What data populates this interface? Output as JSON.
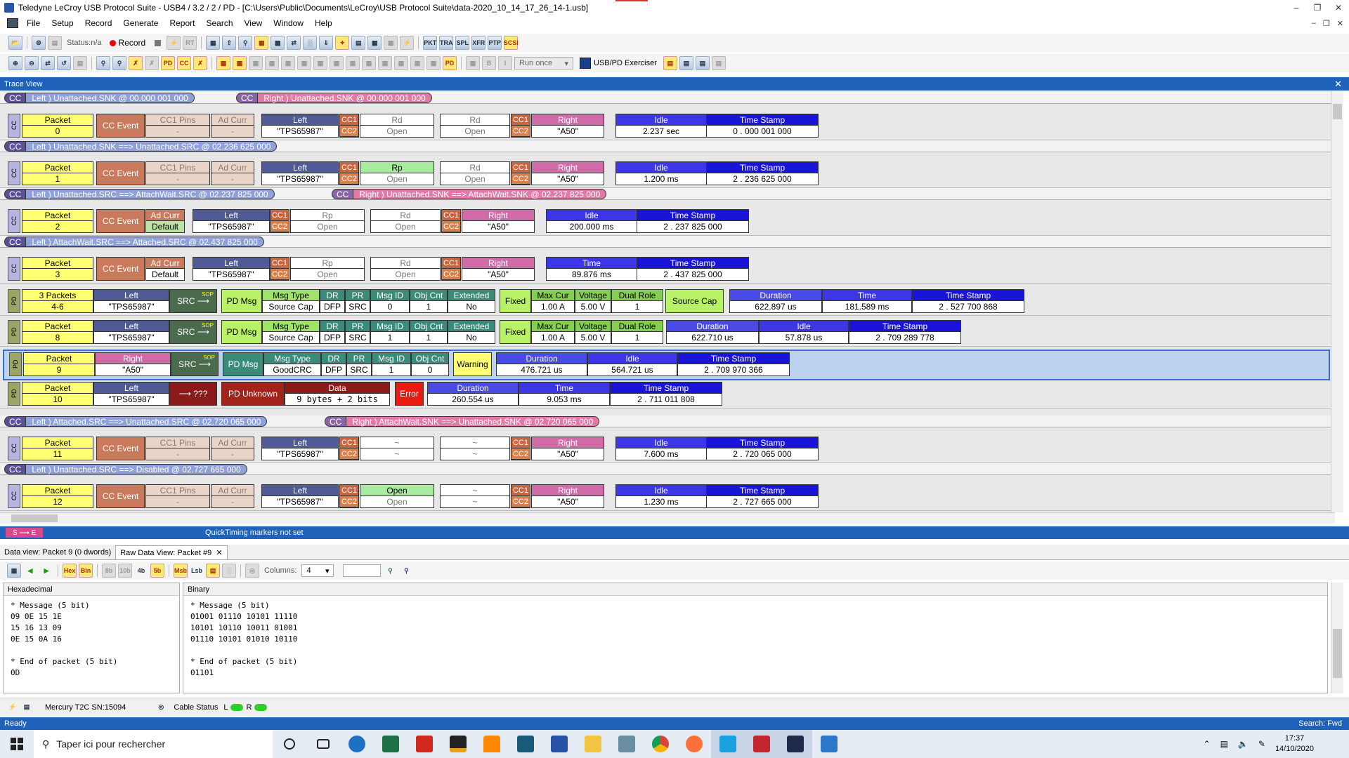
{
  "window": {
    "title": "Teledyne LeCroy USB Protocol Suite - USB4 / 3.2 / 2 / PD - [C:\\Users\\Public\\Documents\\LeCroy\\USB Protocol Suite\\data-2020_10_14_17_26_14-1.usb]"
  },
  "menu": [
    "File",
    "Setup",
    "Record",
    "Generate",
    "Report",
    "Search",
    "View",
    "Window",
    "Help"
  ],
  "toolbar": {
    "status": "Status:n/a",
    "record": "Record",
    "run_mode": "Run once",
    "exerciser": "USB/PD Exerciser"
  },
  "trace_view": {
    "title": "Trace View"
  },
  "transitions": [
    {
      "left": "Left )  Unattached.SNK @ 00.000 001 000",
      "right": "Right )  Unattached.SNK @ 00.000 001 000"
    },
    {
      "left": "Left )  Unattached.SNK ==> Unattached.SRC @ 02.236 625 000",
      "right": ""
    },
    {
      "left": "Left )  Unattached.SRC ==> AttachWait.SRC @ 02.237 825 000",
      "right": "Right )  Unattached.SNK ==> AttachWait.SNK @ 02.237 825 000"
    },
    {
      "left": "Left )  AttachWait.SRC ==> Attached.SRC @ 02.437 825 000",
      "right": ""
    },
    {
      "left": "Left )  Attached.SRC ==> Unattached.SRC @ 02.720 065 000",
      "right": "Right )  AttachWait.SNK ==> Unattached.SNK @ 02.720 065 000"
    },
    {
      "left": "Left )  Unattached.SRC ==> Disabled @ 02.727 665 000",
      "right": ""
    }
  ],
  "labels": {
    "cc": "CC",
    "pd": "PD",
    "packet": "Packet",
    "packets": "3 Packets",
    "cc_event": "CC Event",
    "cc1_pins": "CC1 Pins",
    "ad_curr": "Ad Curr",
    "left": "Left",
    "right": "Right",
    "cc1": "CC1",
    "cc2": "CC2",
    "idle": "Idle",
    "time": "Time",
    "time_stamp": "Time Stamp",
    "duration": "Duration",
    "src": "SRC",
    "sop": "SOP",
    "pd_msg": "PD Msg",
    "msg_type": "Msg Type",
    "dr": "DR",
    "pr": "PR",
    "msg_id": "Msg ID",
    "obj_cnt": "Obj Cnt",
    "extended": "Extended",
    "fixed": "Fixed",
    "max_cur": "Max Cur",
    "voltage": "Voltage",
    "dual_role": "Dual Role",
    "source_cap": "Source Cap",
    "warning": "Warning",
    "pd_unknown": "PD Unknown",
    "data": "Data",
    "error": "Error",
    "unknown_dir": "???",
    "dash": "-",
    "tilde": "~"
  },
  "cc_packets": [
    {
      "num": "0",
      "left": "\"TPS65987\"",
      "right": "\"A50\"",
      "cc1l": "Rd",
      "cc2l": "Open",
      "cc1r": "Rd",
      "cc2r": "Open",
      "idle_label": "Idle",
      "idle": "2.237 sec",
      "ts": "0 . 000 001 000"
    },
    {
      "num": "1",
      "left": "\"TPS65987\"",
      "right": "\"A50\"",
      "cc1l": "Rp",
      "cc2l": "Open",
      "cc1r": "Rd",
      "cc2r": "Open",
      "idle_label": "Idle",
      "idle": "1.200 ms",
      "ts": "2 . 236 625 000"
    },
    {
      "num": "2",
      "adcurr": "Default",
      "left": "\"TPS65987\"",
      "right": "\"A50\"",
      "cc1l": "Rp",
      "cc2l": "Open",
      "cc1r": "Rd",
      "cc2r": "Open",
      "idle_label": "Idle",
      "idle": "200.000 ms",
      "ts": "2 . 237 825 000"
    },
    {
      "num": "3",
      "adcurr": "Default",
      "left": "\"TPS65987\"",
      "right": "\"A50\"",
      "cc1l": "Rp",
      "cc2l": "Open",
      "cc1r": "Rd",
      "cc2r": "Open",
      "idle_label": "Time",
      "idle": "89.876 ms",
      "ts": "2 . 437 825 000"
    },
    {
      "num": "11",
      "left": "\"TPS65987\"",
      "right": "\"A50\"",
      "cc1l": "~",
      "cc2l": "~",
      "cc1r": "~",
      "cc2r": "~",
      "idle_label": "Idle",
      "idle": "7.600 ms",
      "ts": "2 . 720 065 000"
    },
    {
      "num": "12",
      "left": "\"TPS65987\"",
      "right": "\"A50\"",
      "cc1l": "Open",
      "cc2l": "Open",
      "cc1r": "~",
      "cc2r": "~",
      "idle_label": "Idle",
      "idle": "1.230 ms",
      "ts": "2 . 727 665 000"
    }
  ],
  "pd_packets": [
    {
      "num": "4-6",
      "who": "Left",
      "name": "\"TPS65987\"",
      "msgtype": "Source Cap",
      "dr": "DFP",
      "pr": "SRC",
      "msgid": "0",
      "objcnt": "1",
      "ext": "No",
      "maxcur": "1.00 A",
      "volt": "5.00 V",
      "dualrole": "1",
      "dur": "622.897 us",
      "time": "181.589 ms",
      "ts": "2 . 527 700 868"
    },
    {
      "num": "8",
      "who": "Left",
      "name": "\"TPS65987\"",
      "msgtype": "Source Cap",
      "dr": "DFP",
      "pr": "SRC",
      "msgid": "1",
      "objcnt": "1",
      "ext": "No",
      "maxcur": "1.00 A",
      "volt": "5.00 V",
      "dualrole": "1",
      "dur": "622.710 us",
      "idle": "57.878 us",
      "ts": "2 . 709 289 778"
    },
    {
      "num": "9",
      "who": "Right",
      "name": "\"A50\"",
      "msgtype": "GoodCRC",
      "dr": "DFP",
      "pr": "SRC",
      "msgid": "1",
      "objcnt": "0",
      "dur": "476.721 us",
      "idle": "564.721 us",
      "ts": "2 . 709 970 366"
    },
    {
      "num": "10",
      "who": "Left",
      "name": "\"TPS65987\"",
      "data": "9 bytes + 2 bits",
      "dur": "260.554 us",
      "time": "9.053 ms",
      "ts": "2 . 711 011 808"
    }
  ],
  "quicktiming": {
    "se": "S ⟶ E",
    "msg": "QuickTiming markers not set"
  },
  "data_view": {
    "tabs": [
      "Data view: Packet 9 (0 dwords)",
      "Raw Data View: Packet #9"
    ],
    "toolbar": {
      "hex": "Hex",
      "bin": "Bin",
      "b8": "8b",
      "b10": "10b",
      "b4": "4b",
      "b5": "5b",
      "msb": "Msb",
      "lsb": "Lsb",
      "columns_label": "Columns:",
      "columns": "4"
    },
    "hex_title": "Hexadecimal",
    "bin_title": "Binary",
    "hex_text": "* Message (5 bit)\n09 0E 15 1E\n15 16 13 09\n0E 15 0A 16\n\n* End of packet (5 bit)\n0D",
    "bin_text": "* Message (5 bit)\n01001 01110 10101 11110\n10101 10110 10011 01001\n01110 10101 01010 10110\n\n* End of packet (5 bit)\n01101"
  },
  "status": {
    "device": "Mercury T2C SN:15094",
    "cable": "Cable Status",
    "l": "L",
    "r": "R",
    "ready": "Ready",
    "search": "Search: Fwd"
  },
  "taskbar": {
    "search": "Taper ici pour rechercher",
    "time": "17:37",
    "date": "14/10/2020"
  }
}
